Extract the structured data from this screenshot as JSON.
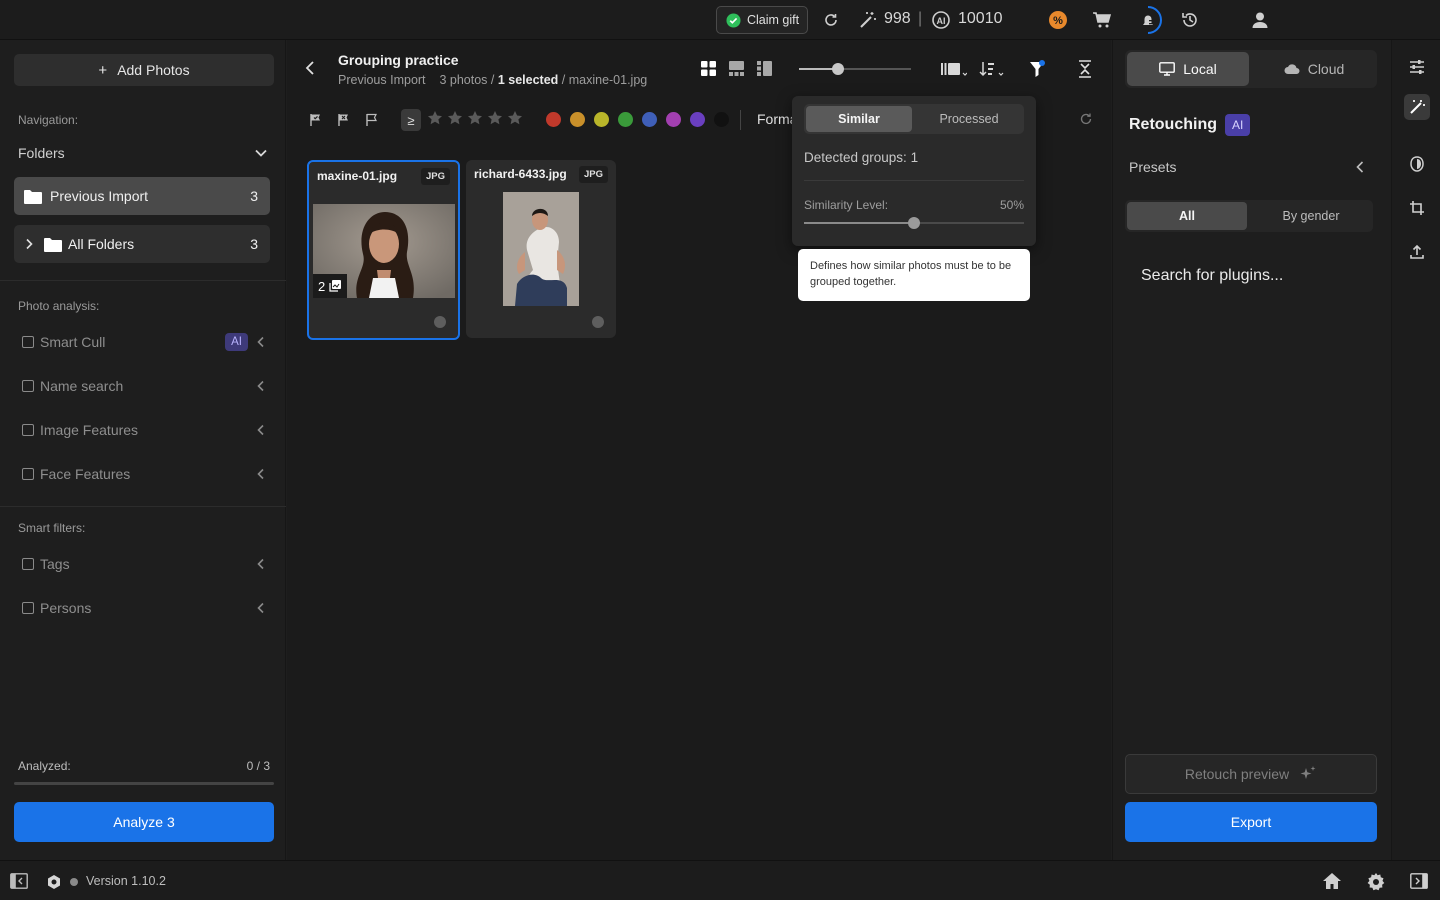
{
  "topbar": {
    "claim_gift": "Claim gift",
    "credits_a": "998",
    "separator": "|",
    "credits_b": "10010"
  },
  "left": {
    "add_photos": "Add Photos",
    "navigation_label": "Navigation:",
    "folders_label": "Folders",
    "folders": [
      {
        "name": "Previous Import",
        "count": "3"
      },
      {
        "name": "All Folders",
        "count": "3"
      }
    ],
    "photo_analysis_label": "Photo analysis:",
    "analysis_items": [
      {
        "label": "Smart Cull",
        "badge": "AI"
      },
      {
        "label": "Name search"
      },
      {
        "label": "Image Features"
      },
      {
        "label": "Face Features"
      }
    ],
    "smart_filters_label": "Smart filters:",
    "filter_items": [
      {
        "label": "Tags"
      },
      {
        "label": "Persons"
      }
    ],
    "analyzed_label": "Analyzed:",
    "analyzed_value": "0 / 3",
    "analyzed_fraction": 0,
    "analyze_button": "Analyze 3"
  },
  "center": {
    "title": "Grouping practice",
    "breadcrumb_folder": "Previous Import",
    "breadcrumb_count": "3 photos /",
    "breadcrumb_selected": "1 selected",
    "breadcrumb_file": "/ maxine-01.jpg",
    "rating_operator": "≥",
    "format_label": "Forma",
    "color_labels": [
      "#c0392b",
      "#c9902a",
      "#b9b52a",
      "#3a9a3a",
      "#3f5fb8",
      "#a23fb0",
      "#6a3fc0",
      "#111111"
    ],
    "photos": [
      {
        "name": "maxine-01.jpg",
        "type": "JPG",
        "group_count": "2"
      },
      {
        "name": "richard-6433.jpg",
        "type": "JPG"
      }
    ]
  },
  "popover": {
    "tab_similar": "Similar",
    "tab_processed": "Processed",
    "detected_groups": "Detected groups: 1",
    "similarity_label": "Similarity Level:",
    "similarity_value": "50%",
    "similarity_fraction": 0.5,
    "tooltip": "Defines how similar photos must be to be grouped together."
  },
  "right": {
    "local": "Local",
    "cloud": "Cloud",
    "retouching": "Retouching",
    "ai_badge": "AI",
    "presets": "Presets",
    "seg_all": "All",
    "seg_gender": "By gender",
    "search_plugins": "Search for plugins...",
    "retouch_preview": "Retouch preview",
    "export": "Export"
  },
  "bottom": {
    "version": "Version 1.10.2"
  }
}
